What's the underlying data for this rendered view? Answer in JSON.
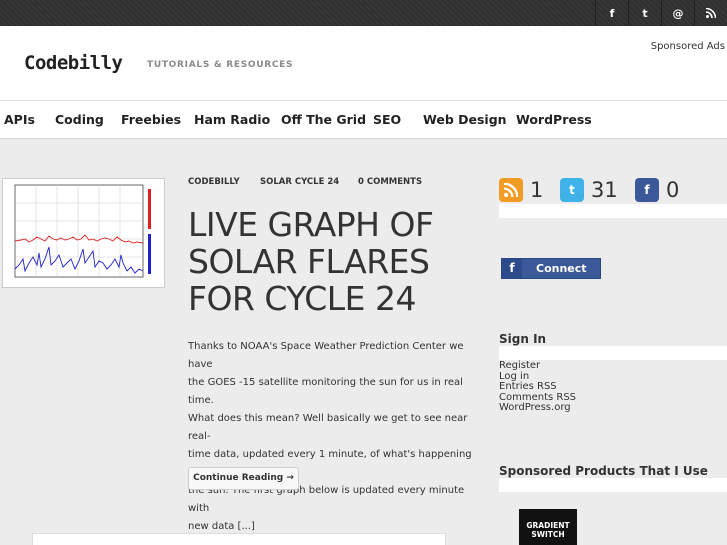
{
  "social": {
    "icons": [
      {
        "name": "facebook-icon",
        "glyph": "f"
      },
      {
        "name": "twitter-icon",
        "glyph": "t"
      },
      {
        "name": "email-icon",
        "glyph": "@"
      },
      {
        "name": "rss-icon",
        "glyph": "⌘"
      }
    ]
  },
  "header": {
    "logo": "Codebilly",
    "tagline": "TUTORIALS & RESOURCES",
    "sponsored": "Sponsored Ads"
  },
  "nav": {
    "items": [
      "APIs",
      "Coding",
      "Freebies",
      "Ham Radio",
      "Off The Grid",
      "SEO",
      "Web Design",
      "WordPress"
    ]
  },
  "post": {
    "meta": {
      "author": "CODEBILLY",
      "category": "SOLAR CYCLE 24",
      "comments": "0 COMMENTS"
    },
    "title_lines": [
      "LIVE GRAPH OF",
      "SOLAR FLARES",
      "FOR CYCLE 24"
    ],
    "excerpt_lines": [
      "Thanks to NOAA's Space Weather Prediction Center we have",
      "the GOES -15 satellite monitoring the sun for us in real time.",
      "What does this mean? Well basically we get to see near real-",
      "time data, updated every 1 minute, of what's happening on",
      "the sun. The first graph below is updated every minute with",
      "new data [...]"
    ],
    "continue_label": "Continue Reading →"
  },
  "sidebar": {
    "counters": [
      {
        "icon": "rss-icon",
        "value": "1",
        "color": "#f39c24"
      },
      {
        "icon": "twitter-icon",
        "value": "31",
        "color": "#3fb3e8"
      },
      {
        "icon": "facebook-icon",
        "value": "0",
        "color": "#3b5998"
      }
    ],
    "connect_label": "Connect",
    "signin_title": "Sign In",
    "links": [
      "Register",
      "Log in",
      "Entries RSS",
      "Comments RSS",
      "WordPress.org"
    ],
    "sponsored_title": "Sponsored Products That I Use",
    "product_lines": [
      "GRADIENT",
      "SWITCH"
    ]
  }
}
